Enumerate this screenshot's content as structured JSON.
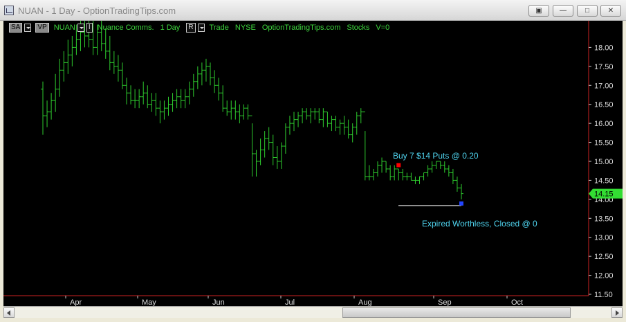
{
  "window": {
    "title": "NUAN - 1 Day - OptionTradingTips.com",
    "buttons": [
      "restore-alt",
      "minimize",
      "maximize",
      "close"
    ]
  },
  "toolbar": {
    "sa_label": "SA",
    "vp_label": "VP",
    "symbol": "NUAN",
    "i_label": "I",
    "company": "Nuance Comms.",
    "interval": "1 Day",
    "r_label": "R",
    "trade": "Trade",
    "exchange": "NYSE",
    "site": "OptionTradingTips.com",
    "category": "Stocks",
    "volume": "V=0"
  },
  "colors": {
    "background": "#000000",
    "bars": "#2ecc2e",
    "axis_line": "#cc2222",
    "annotation_text": "#4fd3ee",
    "price_tag": "#33dd33",
    "buy_marker": "#ff0000",
    "close_marker": "#2244ff"
  },
  "chart_data": {
    "type": "ohlc",
    "x_tick_labels": [
      "Apr",
      "May",
      "Jun",
      "Jul",
      "Aug",
      "Sep",
      "Oct"
    ],
    "y_tick_labels": [
      "18.00",
      "17.50",
      "17.00",
      "16.50",
      "16.00",
      "15.50",
      "15.00",
      "14.50",
      "14.00",
      "13.50",
      "13.00",
      "12.50",
      "12.00",
      "11.50"
    ],
    "ylim": [
      11.5,
      18.7
    ],
    "last_price": "14.15",
    "series": [
      {
        "values": [
          [
            16.9,
            17.1,
            15.7,
            16.2
          ],
          [
            16.2,
            16.6,
            15.9,
            16.3
          ],
          [
            16.3,
            16.8,
            16.1,
            16.6
          ],
          [
            16.6,
            17.3,
            16.3,
            16.9
          ],
          [
            16.9,
            17.7,
            16.7,
            17.4
          ],
          [
            17.4,
            17.9,
            17.1,
            17.6
          ],
          [
            17.6,
            18.2,
            17.3,
            17.8
          ],
          [
            17.8,
            18.3,
            17.5,
            18.0
          ],
          [
            18.0,
            18.6,
            17.8,
            18.2
          ],
          [
            18.2,
            18.7,
            17.9,
            18.4
          ],
          [
            18.4,
            18.7,
            18.0,
            18.3
          ],
          [
            18.3,
            18.7,
            18.0,
            18.2
          ],
          [
            18.2,
            18.7,
            17.8,
            18.0
          ],
          [
            18.0,
            18.6,
            17.8,
            18.4
          ],
          [
            18.4,
            18.7,
            17.9,
            18.1
          ],
          [
            18.1,
            18.5,
            17.7,
            17.9
          ],
          [
            17.9,
            18.3,
            17.4,
            17.6
          ],
          [
            17.6,
            17.9,
            17.3,
            17.5
          ],
          [
            17.5,
            17.8,
            17.1,
            17.4
          ],
          [
            17.4,
            17.6,
            16.9,
            17.0
          ],
          [
            17.0,
            17.2,
            16.5,
            16.8
          ],
          [
            16.8,
            17.0,
            16.5,
            16.6
          ],
          [
            16.6,
            16.9,
            16.4,
            16.6
          ],
          [
            16.6,
            16.9,
            16.4,
            16.7
          ],
          [
            16.7,
            17.1,
            16.5,
            16.8
          ],
          [
            16.8,
            17.0,
            16.4,
            16.5
          ],
          [
            16.5,
            16.8,
            16.3,
            16.6
          ],
          [
            16.6,
            16.8,
            16.2,
            16.4
          ],
          [
            16.4,
            16.6,
            16.0,
            16.3
          ],
          [
            16.3,
            16.6,
            16.1,
            16.4
          ],
          [
            16.4,
            16.7,
            16.2,
            16.5
          ],
          [
            16.5,
            16.8,
            16.3,
            16.6
          ],
          [
            16.6,
            16.9,
            16.4,
            16.7
          ],
          [
            16.7,
            16.9,
            16.4,
            16.6
          ],
          [
            16.6,
            16.9,
            16.4,
            16.7
          ],
          [
            16.7,
            17.1,
            16.5,
            16.9
          ],
          [
            16.9,
            17.3,
            16.7,
            17.1
          ],
          [
            17.1,
            17.5,
            16.9,
            17.3
          ],
          [
            17.3,
            17.6,
            17.0,
            17.4
          ],
          [
            17.4,
            17.7,
            17.1,
            17.5
          ],
          [
            17.5,
            17.6,
            17.0,
            17.2
          ],
          [
            17.2,
            17.4,
            16.8,
            17.0
          ],
          [
            17.0,
            17.2,
            16.6,
            16.8
          ],
          [
            16.8,
            17.0,
            16.3,
            16.4
          ],
          [
            16.4,
            16.6,
            16.2,
            16.3
          ],
          [
            16.3,
            16.6,
            16.1,
            16.4
          ],
          [
            16.4,
            16.6,
            16.1,
            16.3
          ],
          [
            16.3,
            16.5,
            16.0,
            16.2
          ],
          [
            16.2,
            16.5,
            16.1,
            16.4
          ],
          [
            16.4,
            16.5,
            16.1,
            16.2
          ],
          [
            16.2,
            16.0,
            14.6,
            15.2
          ],
          [
            15.2,
            15.3,
            14.6,
            15.0
          ],
          [
            15.0,
            15.6,
            14.9,
            15.3
          ],
          [
            15.3,
            15.8,
            15.1,
            15.6
          ],
          [
            15.6,
            15.9,
            15.3,
            15.5
          ],
          [
            15.5,
            15.7,
            14.9,
            15.1
          ],
          [
            15.1,
            15.4,
            14.8,
            15.0
          ],
          [
            15.0,
            15.5,
            14.8,
            15.4
          ],
          [
            15.4,
            16.0,
            15.2,
            15.9
          ],
          [
            15.9,
            16.2,
            15.7,
            16.0
          ],
          [
            16.0,
            16.3,
            15.8,
            16.1
          ],
          [
            16.1,
            16.3,
            15.9,
            16.2
          ],
          [
            16.2,
            16.4,
            16.0,
            16.3
          ],
          [
            16.3,
            16.4,
            16.1,
            16.2
          ],
          [
            16.2,
            16.4,
            16.0,
            16.3
          ],
          [
            16.3,
            16.4,
            16.1,
            16.3
          ],
          [
            16.3,
            16.4,
            16.0,
            16.1
          ],
          [
            16.1,
            16.4,
            15.9,
            16.3
          ],
          [
            16.3,
            16.3,
            15.9,
            16.0
          ],
          [
            16.0,
            16.2,
            15.8,
            16.1
          ],
          [
            16.1,
            16.2,
            15.8,
            15.9
          ],
          [
            15.9,
            16.1,
            15.7,
            16.0
          ],
          [
            16.0,
            16.2,
            15.7,
            15.9
          ],
          [
            15.9,
            16.1,
            15.6,
            15.7
          ],
          [
            15.7,
            16.0,
            15.5,
            15.9
          ],
          [
            15.9,
            16.3,
            15.7,
            16.2
          ],
          [
            16.2,
            16.4,
            16.0,
            16.3
          ],
          [
            16.3,
            15.8,
            14.5,
            14.6
          ],
          [
            14.6,
            14.9,
            14.5,
            14.6
          ],
          [
            14.6,
            14.8,
            14.5,
            14.7
          ],
          [
            14.7,
            15.0,
            14.6,
            14.9
          ],
          [
            14.9,
            15.1,
            14.7,
            15.0
          ],
          [
            15.0,
            15.0,
            14.7,
            14.8
          ],
          [
            14.8,
            14.9,
            14.5,
            14.6
          ],
          [
            14.6,
            14.9,
            14.5,
            14.8
          ],
          [
            14.8,
            14.8,
            14.5,
            14.7
          ],
          [
            14.7,
            14.8,
            14.5,
            14.6
          ],
          [
            14.6,
            14.7,
            14.5,
            14.6
          ],
          [
            14.6,
            14.7,
            14.5,
            14.5
          ],
          [
            14.5,
            14.6,
            14.4,
            14.5
          ],
          [
            14.5,
            14.6,
            14.4,
            14.6
          ],
          [
            14.6,
            14.7,
            14.5,
            14.7
          ],
          [
            14.7,
            14.9,
            14.6,
            14.8
          ],
          [
            14.8,
            15.0,
            14.7,
            14.9
          ],
          [
            14.9,
            15.0,
            14.8,
            15.0
          ],
          [
            15.0,
            15.0,
            14.8,
            14.9
          ],
          [
            14.9,
            15.0,
            14.7,
            14.8
          ],
          [
            14.8,
            14.9,
            14.6,
            14.7
          ],
          [
            14.7,
            14.8,
            14.4,
            14.5
          ],
          [
            14.5,
            14.6,
            14.2,
            14.3
          ],
          [
            14.3,
            14.4,
            14.0,
            14.15
          ]
        ]
      }
    ],
    "annotations": [
      {
        "text": "Buy 7 $14 Puts @ 0.20",
        "price": 14.9
      },
      {
        "text": "Expired Worthless, Closed @ 0",
        "price": 13.85
      }
    ]
  }
}
